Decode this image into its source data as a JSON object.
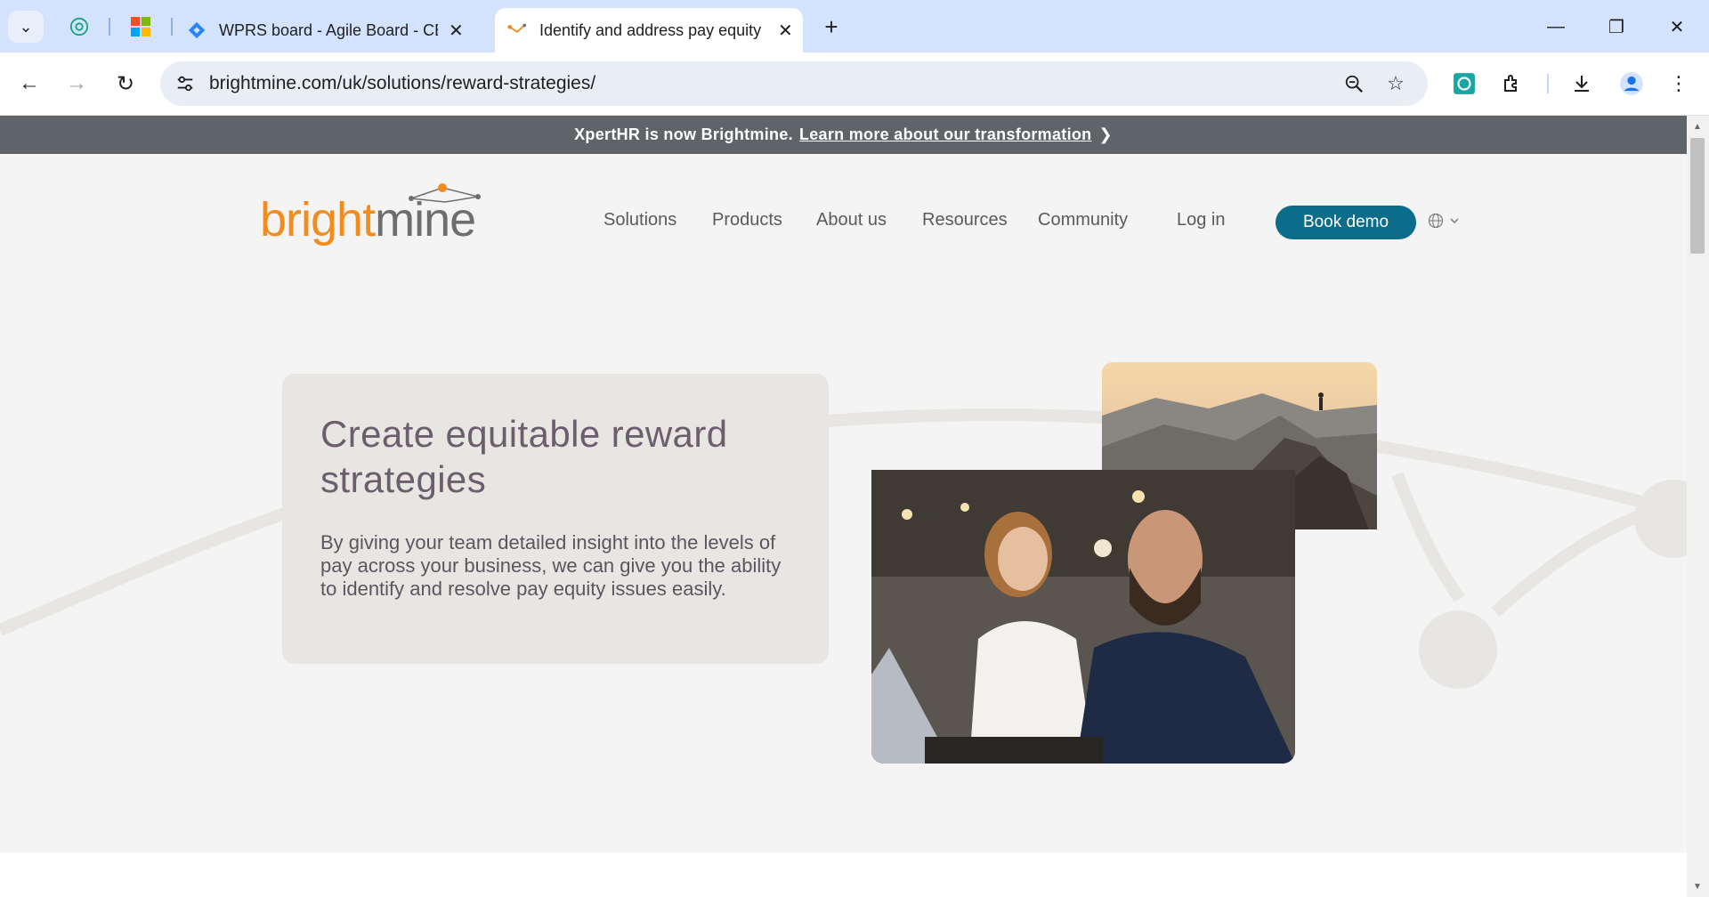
{
  "browser": {
    "tabs": [
      {
        "title": "WPRS board - Agile Board - CE",
        "active": false
      },
      {
        "title": "Identify and address pay equity",
        "active": true
      }
    ],
    "url": "brightmine.com/uk/solutions/reward-strategies/"
  },
  "banner": {
    "text": "XpertHR is now Brightmine.",
    "link": "Learn more about our transformation"
  },
  "site": {
    "logo_text": "brightmine",
    "nav": [
      "Solutions",
      "Products",
      "About us",
      "Resources",
      "Community",
      "Log in"
    ],
    "cta": "Book demo"
  },
  "hero": {
    "title": "Create equitable reward strategies",
    "body": "By giving your team detailed insight into the levels of pay across your business, we can give you the ability to identify and resolve pay equity issues easily."
  },
  "colors": {
    "brand_orange": "#f28c1c",
    "brand_grey": "#6d6e70",
    "cta_teal": "#0b6d8a",
    "banner_bg": "#5f6469"
  }
}
